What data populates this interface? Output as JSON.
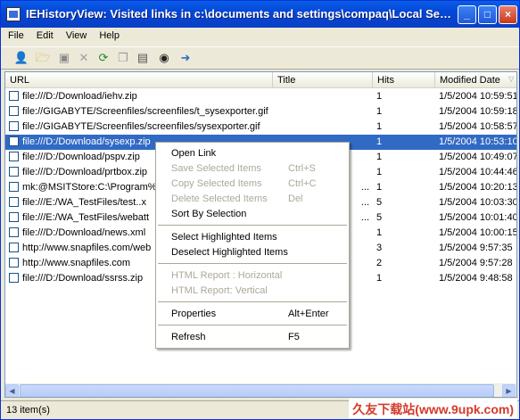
{
  "window": {
    "title": "IEHistoryView: Visited links in c:\\documents and settings\\compaq\\Local Set..."
  },
  "titlebar_buttons": {
    "minimize": "_",
    "maximize": "□",
    "close": "×"
  },
  "menu": [
    "File",
    "Edit",
    "View",
    "Help"
  ],
  "toolbar": [
    "person-icon",
    "folder-open-icon",
    "save-icon",
    "delete-icon",
    "refresh-icon",
    "copy-icon",
    "properties-icon",
    "find-icon",
    "exit-icon"
  ],
  "columns": {
    "url": "URL",
    "title": "Title",
    "hits": "Hits",
    "modified": "Modified Date"
  },
  "rows": [
    {
      "url": "file:///D:/Download/iehv.zip",
      "title": "",
      "hits": "1",
      "modified": "1/5/2004 10:59:51"
    },
    {
      "url": "file://GIGABYTE/Screenfiles/screenfiles/t_sysexporter.gif",
      "title": "",
      "hits": "1",
      "modified": "1/5/2004 10:59:18"
    },
    {
      "url": "file://GIGABYTE/Screenfiles/screenfiles/sysexporter.gif",
      "title": "",
      "hits": "1",
      "modified": "1/5/2004 10:58:57"
    },
    {
      "url": "file:///D:/Download/sysexp.zip",
      "title": "",
      "hits": "1",
      "modified": "1/5/2004 10:53:10"
    },
    {
      "url": "file:///D:/Download/pspv.zip",
      "title": "",
      "hits": "1",
      "modified": "1/5/2004 10:49:07"
    },
    {
      "url": "file:///D:/Download/prtbox.zip",
      "title": "",
      "hits": "1",
      "modified": "1/5/2004 10:44:46"
    },
    {
      "url": "mk:@MSITStore:C:\\Program%",
      "title": "...",
      "hits": "1",
      "modified": "1/5/2004 10:20:13"
    },
    {
      "url": "file:///E:/WA_TestFiles/test..x",
      "title": "...",
      "hits": "5",
      "modified": "1/5/2004 10:03:30"
    },
    {
      "url": "file:///E:/WA_TestFiles/webatt",
      "title": "...",
      "hits": "5",
      "modified": "1/5/2004 10:01:40"
    },
    {
      "url": "file:///D:/Download/news.xml",
      "title": "",
      "hits": "1",
      "modified": "1/5/2004 10:00:15"
    },
    {
      "url": "http://www.snapfiles.com/web",
      "title": "",
      "hits": "3",
      "modified": "1/5/2004 9:57:35"
    },
    {
      "url": "http://www.snapfiles.com",
      "title": "",
      "hits": "2",
      "modified": "1/5/2004 9:57:28"
    },
    {
      "url": "file:///D:/Download/ssrss.zip",
      "title": "",
      "hits": "1",
      "modified": "1/5/2004 9:48:58"
    }
  ],
  "context_menu": {
    "open_link": "Open Link",
    "save_selected": "Save Selected Items",
    "save_selected_sc": "Ctrl+S",
    "copy_selected": "Copy Selected Items",
    "copy_selected_sc": "Ctrl+C",
    "delete_selected": "Delete Selected Items",
    "delete_selected_sc": "Del",
    "sort_by_selection": "Sort By Selection",
    "select_highlighted": "Select Highlighted Items",
    "deselect_highlighted": "Deselect Highlighted Items",
    "html_horizontal": "HTML Report : Horizontal",
    "html_vertical": "HTML Report: Vertical",
    "properties": "Properties",
    "properties_sc": "Alt+Enter",
    "refresh": "Refresh",
    "refresh_sc": "F5"
  },
  "status": {
    "count": "13 item(s)"
  },
  "watermark": "久友下载站(www.9upk.com)",
  "colors": {
    "titlebar": "#0a5ee6",
    "selection": "#316ac5"
  }
}
